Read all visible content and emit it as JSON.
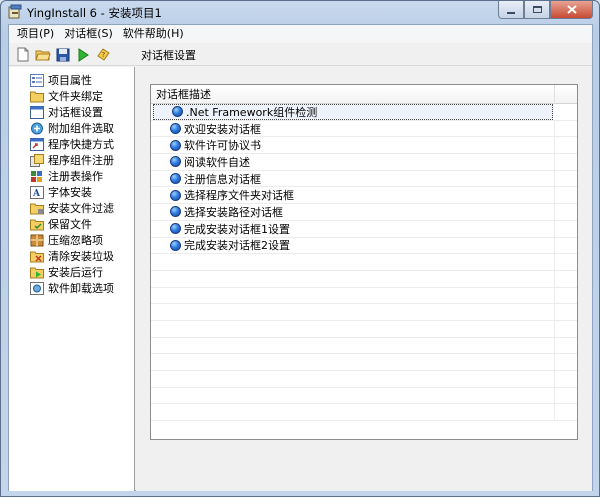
{
  "window": {
    "title": "YingInstall 6 - 安装项目1"
  },
  "menu": {
    "items": [
      "项目(P)",
      "对话框(S)",
      "软件帮助(H)"
    ]
  },
  "toolbar": {
    "title": "对话框设置",
    "buttons": [
      "new-icon",
      "open-folder-icon",
      "save-icon",
      "run-icon",
      "help-icon"
    ]
  },
  "sidebar": {
    "items": [
      {
        "label": "项目属性",
        "icon": "project-properties-icon"
      },
      {
        "label": "文件夹绑定",
        "icon": "folder-icon"
      },
      {
        "label": "对话框设置",
        "icon": "dialog-icon"
      },
      {
        "label": "附加组件选取",
        "icon": "addon-icon"
      },
      {
        "label": "程序快捷方式",
        "icon": "shortcut-icon"
      },
      {
        "label": "程序组件注册",
        "icon": "component-icon"
      },
      {
        "label": "注册表操作",
        "icon": "registry-icon"
      },
      {
        "label": "字体安装",
        "icon": "font-icon"
      },
      {
        "label": "安装文件过滤",
        "icon": "filter-icon"
      },
      {
        "label": "保留文件",
        "icon": "keep-file-icon"
      },
      {
        "label": "压缩忽略项",
        "icon": "compress-icon"
      },
      {
        "label": "清除安装垃圾",
        "icon": "cleanup-icon"
      },
      {
        "label": "安装后运行",
        "icon": "run-after-icon"
      },
      {
        "label": "软件卸载选项",
        "icon": "uninstall-icon"
      }
    ]
  },
  "dialog_list": {
    "header": "对话框描述",
    "rows": [
      ".Net Framework组件检测",
      "欢迎安装对话框",
      "软件许可协议书",
      "阅读软件自述",
      "注册信息对话框",
      "选择程序文件夹对话框",
      "选择安装路径对话框",
      "完成安装对话框1设置",
      "完成安装对话框2设置"
    ],
    "selected_index": 0,
    "empty_rows": 11
  }
}
